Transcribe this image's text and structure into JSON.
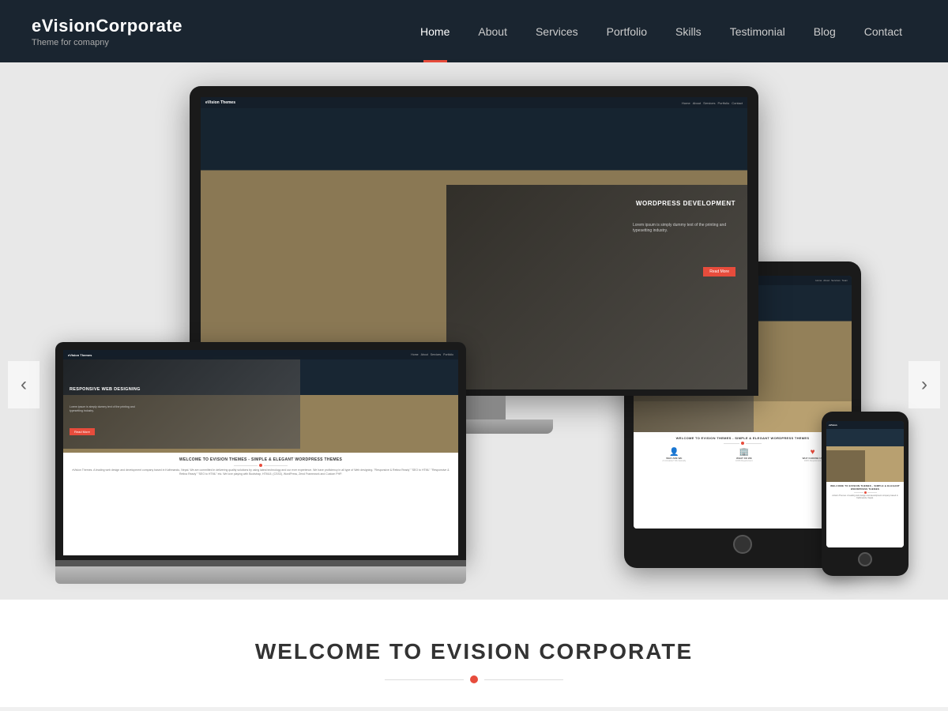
{
  "brand": {
    "name": "eVisionCorporate",
    "tagline": "Theme for comapny"
  },
  "nav": {
    "items": [
      {
        "label": "Home",
        "active": true
      },
      {
        "label": "About",
        "active": false
      },
      {
        "label": "Services",
        "active": false
      },
      {
        "label": "Portfolio",
        "active": false
      },
      {
        "label": "Skills",
        "active": false
      },
      {
        "label": "Testimonial",
        "active": false
      },
      {
        "label": "Blog",
        "active": false
      },
      {
        "label": "Contact",
        "active": false
      }
    ]
  },
  "carousel": {
    "left_arrow": "‹",
    "right_arrow": "›"
  },
  "screen_content": {
    "nav_logo": "eVision Themes",
    "hero_title": "WORDPRESS DEVELOPMENT",
    "btn_label": "Read More"
  },
  "welcome": {
    "title": "WELCOME TO EVISION CORPORATE",
    "divider_dot_color": "#e74c3c"
  },
  "laptop_screen": {
    "hero_title": "RESPONSIVE WEB DESIGNING",
    "btn_label": "Read More",
    "welcome_text": "WELCOME TO EVISION THEMES - SIMPLE & ELEGANT WORDPRESS THEMES",
    "description": "eVision Themes. A leading web design and development company based in Kathmandu, Nepal. We are committed in delivering quality solutions by using latest technology and our ever experience. We have proficiency in all type of Web designing. We love playing with Bootstrap, HTML5, (CSS3), WordPress, Zend Framework and Custom PHP."
  },
  "colors": {
    "accent": "#e74c3c",
    "navbar_bg": "#1a2530",
    "device_bg": "#1a1a1a",
    "screen_dark": "#1e3040",
    "hero_bg": "#e8e8e8"
  }
}
